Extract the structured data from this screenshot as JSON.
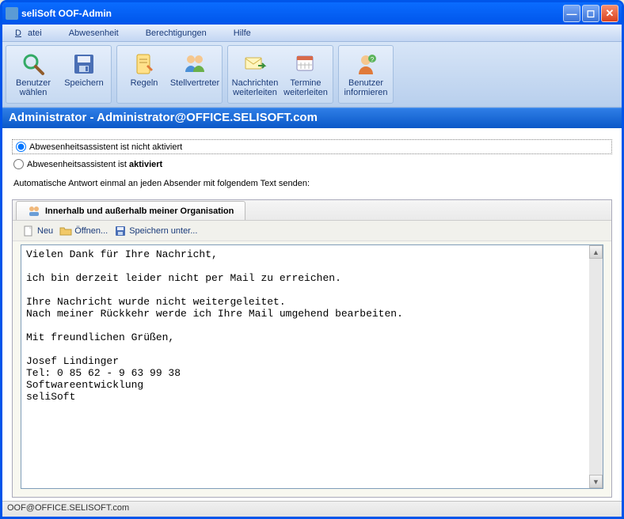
{
  "window": {
    "title": "seliSoft OOF-Admin"
  },
  "menu": {
    "datei": "Datei",
    "abwesenheit": "Abwesenheit",
    "berechtigungen": "Berechtigungen",
    "hilfe": "Hilfe"
  },
  "toolbar": {
    "benutzer_waehlen": "Benutzer\nwählen",
    "speichern": "Speichern",
    "regeln": "Regeln",
    "stellvertreter": "Stellvertreter",
    "nachrichten_weiterleiten": "Nachrichten\nweiterleiten",
    "termine_weiterleiten": "Termine\nweiterleiten",
    "benutzer_informieren": "Benutzer\ninformieren"
  },
  "admin_line": "Administrator - Administrator@OFFICE.SELISOFT.com",
  "radios": {
    "not_active_prefix": "Abwesenheitsassistent ist ",
    "not_active_bold": "nicht aktiviert",
    "active_prefix": "Abwesenheitsassistent ist ",
    "active_bold": "aktiviert",
    "selected": "not_active"
  },
  "auto_text": "Automatische Antwort einmal an jeden Absender mit folgendem Text senden:",
  "tab": {
    "label": "Innerhalb und außerhalb meiner Organisation"
  },
  "edit_toolbar": {
    "neu": "Neu",
    "oeffnen": "Öffnen...",
    "speichern_unter": "Speichern unter..."
  },
  "reply_body": "Vielen Dank für Ihre Nachricht,\n\nich bin derzeit leider nicht per Mail zu erreichen.\n\nIhre Nachricht wurde nicht weitergeleitet.\nNach meiner Rückkehr werde ich Ihre Mail umgehend bearbeiten.\n\nMit freundlichen Grüßen,\n\nJosef Lindinger\nTel: 0 85 62 - 9 63 99 38\nSoftwareentwicklung\nseliSoft",
  "statusbar": "OOF@OFFICE.SELISOFT.com"
}
